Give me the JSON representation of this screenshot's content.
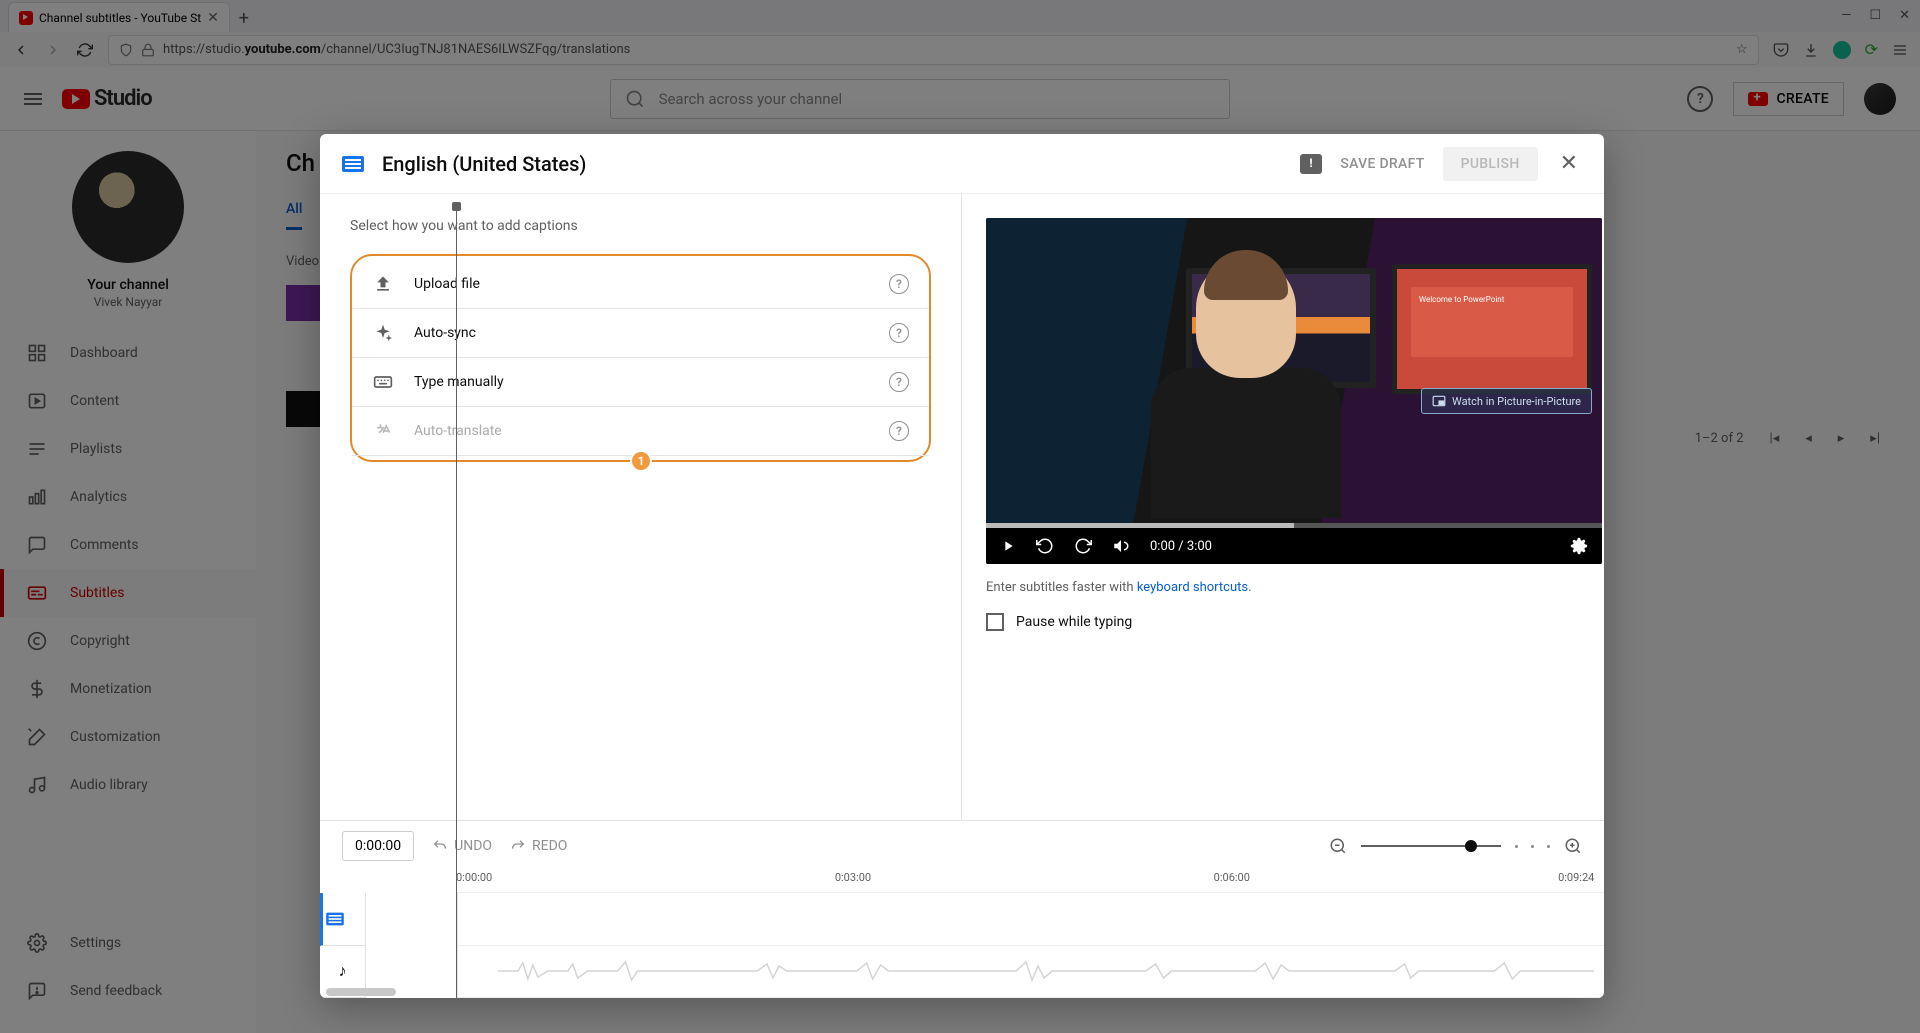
{
  "browser": {
    "tab_title": "Channel subtitles - YouTube St",
    "url_prefix": "https://studio.",
    "url_domain": "youtube.com",
    "url_path": "/channel/UC3IugTNJ81NAES6ILWSZFqg/translations"
  },
  "header": {
    "logo_text": "Studio",
    "search_placeholder": "Search across your channel",
    "create_label": "CREATE"
  },
  "sidebar": {
    "your_channel": "Your channel",
    "channel_name": "Vivek Nayyar",
    "items_top": [
      {
        "label": "Dashboard",
        "icon": "dashboard"
      },
      {
        "label": "Content",
        "icon": "content"
      },
      {
        "label": "Playlists",
        "icon": "playlists"
      },
      {
        "label": "Analytics",
        "icon": "analytics"
      },
      {
        "label": "Comments",
        "icon": "comments"
      },
      {
        "label": "Subtitles",
        "icon": "subtitles",
        "active": true
      },
      {
        "label": "Copyright",
        "icon": "copyright"
      },
      {
        "label": "Monetization",
        "icon": "monetization"
      },
      {
        "label": "Customization",
        "icon": "customization"
      },
      {
        "label": "Audio library",
        "icon": "audio"
      }
    ],
    "items_bottom": [
      {
        "label": "Settings",
        "icon": "settings"
      },
      {
        "label": "Send feedback",
        "icon": "feedback"
      }
    ]
  },
  "content_bg": {
    "heading_partial": "Ch",
    "tab_all": "All",
    "col_video": "Video",
    "pagination": "1–2 of 2"
  },
  "modal": {
    "title": "English (United States)",
    "save_draft": "SAVE DRAFT",
    "publish": "PUBLISH",
    "instruction": "Select how you want to add captions",
    "options": [
      {
        "label": "Upload file",
        "icon": "upload",
        "enabled": true
      },
      {
        "label": "Auto-sync",
        "icon": "sparkle",
        "enabled": true
      },
      {
        "label": "Type manually",
        "icon": "keyboard",
        "enabled": true
      },
      {
        "label": "Auto-translate",
        "icon": "translate",
        "enabled": false
      }
    ],
    "annotation_badge": "1",
    "video": {
      "pip_label": "Watch in Picture-in-Picture",
      "time_current": "0:00",
      "time_total": "3:00",
      "slide_title": "Welcome to PowerPoint"
    },
    "hint_prefix": "Enter subtitles faster with ",
    "hint_link": "keyboard shortcuts",
    "hint_suffix": ".",
    "pause_label": "Pause while typing",
    "timeline": {
      "timecode": "0:00:00",
      "undo": "UNDO",
      "redo": "REDO",
      "marks": [
        "0:00:00",
        "0:03:00",
        "0:06:00",
        "0:09:24"
      ]
    }
  }
}
